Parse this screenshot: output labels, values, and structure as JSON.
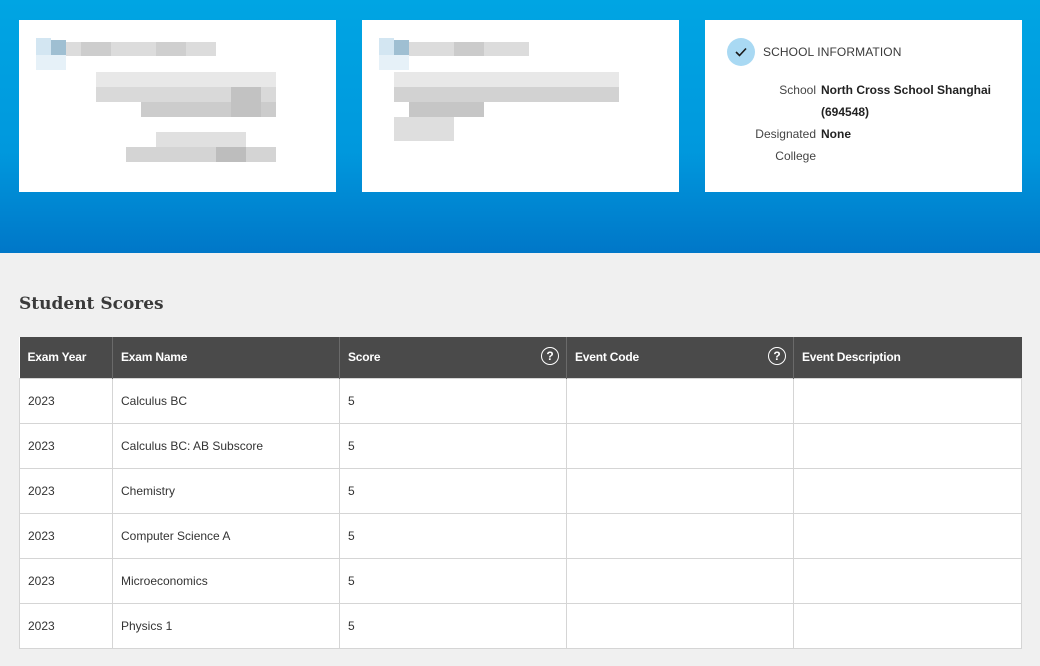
{
  "school_card": {
    "title": "SCHOOL INFORMATION",
    "rows": [
      {
        "label": "School",
        "value": "North Cross School Shanghai (694548)"
      },
      {
        "label": "Designated College",
        "value": "None"
      }
    ]
  },
  "scores_section": {
    "title": "Student Scores",
    "columns": [
      "Exam Year",
      "Exam Name",
      "Score",
      "Event Code",
      "Event Description"
    ],
    "help_icon_glyph": "?",
    "rows": [
      {
        "year": "2023",
        "exam": "Calculus BC",
        "score": "5",
        "event_code": "",
        "event_description": ""
      },
      {
        "year": "2023",
        "exam": "Calculus BC: AB Subscore",
        "score": "5",
        "event_code": "",
        "event_description": ""
      },
      {
        "year": "2023",
        "exam": "Chemistry",
        "score": "5",
        "event_code": "",
        "event_description": ""
      },
      {
        "year": "2023",
        "exam": "Computer Science A",
        "score": "5",
        "event_code": "",
        "event_description": ""
      },
      {
        "year": "2023",
        "exam": "Microeconomics",
        "score": "5",
        "event_code": "",
        "event_description": ""
      },
      {
        "year": "2023",
        "exam": "Physics 1",
        "score": "5",
        "event_code": "",
        "event_description": ""
      }
    ]
  },
  "colors": {
    "hero_top": "#00a5e3",
    "hero_bottom": "#0077c8",
    "table_header": "#4a4a4a",
    "check_circle": "#a9d9f3"
  }
}
